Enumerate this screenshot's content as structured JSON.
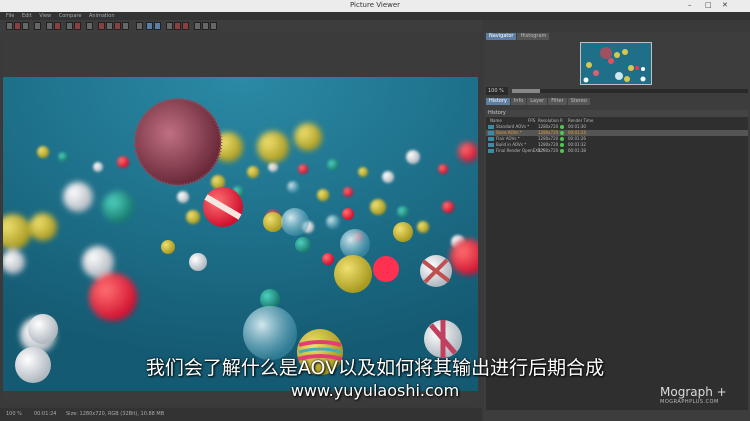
{
  "window": {
    "title": "Picture Viewer",
    "controls": [
      "–",
      "□",
      "✕"
    ]
  },
  "menu": [
    "File",
    "Edit",
    "View",
    "Compare",
    "Animation"
  ],
  "right_panel": {
    "top_tabs": [
      {
        "label": "Navigator",
        "active": true
      },
      {
        "label": "Histogram",
        "active": false
      }
    ],
    "zoom": {
      "value": "100 %",
      "fraction": 0.12
    },
    "mid_tabs": [
      {
        "label": "History",
        "active": true
      },
      {
        "label": "Info",
        "active": false
      },
      {
        "label": "Layer",
        "active": false
      },
      {
        "label": "Filter",
        "active": false
      },
      {
        "label": "Stereo",
        "active": false
      }
    ],
    "history": {
      "title": "History",
      "columns": {
        "name": "Name",
        "fps": "FPS",
        "resolution": "Resolution",
        "r": "R",
        "render_time": "Render Time"
      },
      "rows": [
        {
          "name": "Standard AOVs *",
          "resolution": "1280x720",
          "time": "00:01:30",
          "selected": false
        },
        {
          "name": "Store AOVs *",
          "resolution": "1280x720",
          "time": "00:01:24",
          "selected": true
        },
        {
          "name": "Flair AOVs *",
          "resolution": "1280x720",
          "time": "00:01:26",
          "selected": false
        },
        {
          "name": "Build in AOVs *",
          "resolution": "1280x720",
          "time": "00:01:32",
          "selected": false
        },
        {
          "name": "Final Render OpenEXR *",
          "resolution": "1280x720",
          "time": "00:01:38",
          "selected": false
        }
      ]
    }
  },
  "statusbar": {
    "zoom": "100 %",
    "time": "00:01:24",
    "info": "Size: 1280x720, RGB (32Bit), 10.88 MB"
  },
  "subtitle": "我们会了解什么是AOV以及如何将其输出进行后期合成",
  "website": "www.yuyulaoshi.com",
  "watermark": {
    "brand": "Mograph",
    "plus": "+",
    "site": "MOGRAPHPLUS.COM"
  },
  "colors": {
    "render_bg": "#1d6c86",
    "selected_text": "#e8a030",
    "tab_active": "#5d7ea2"
  }
}
